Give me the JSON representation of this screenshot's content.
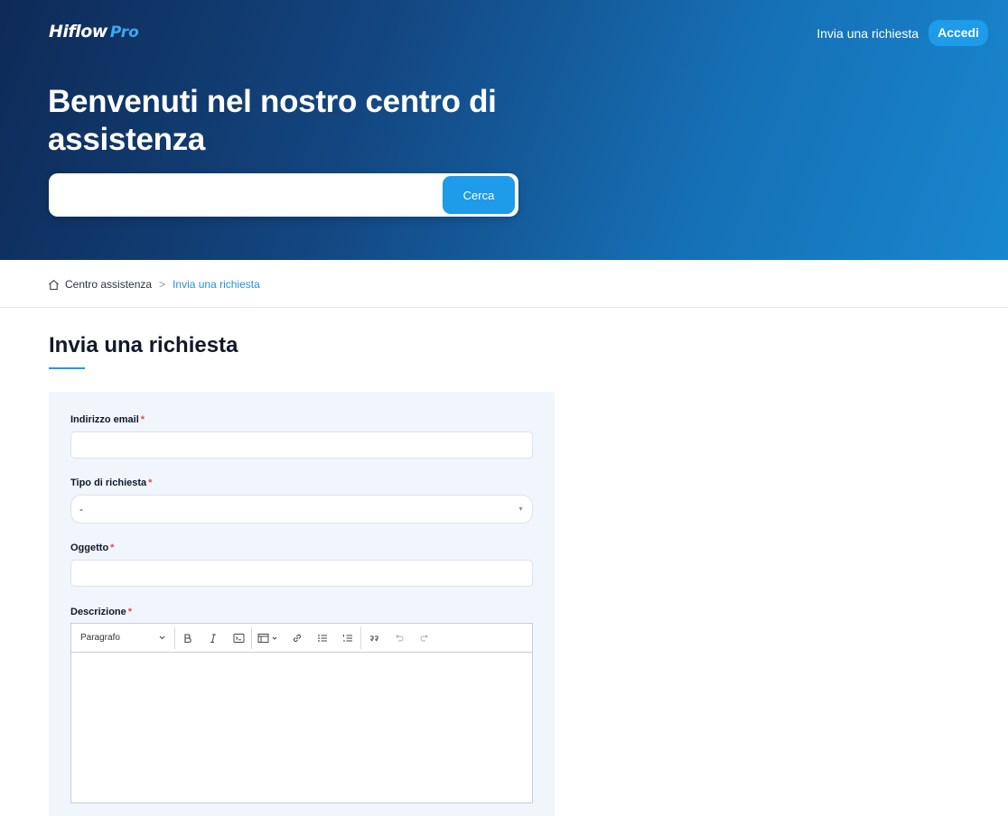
{
  "header": {
    "brand": "Hiflow",
    "brand_suffix": "Pro",
    "nav_link": "Invia una richiesta",
    "login_label": "Accedi",
    "hero_title": "Benvenuti nel nostro centro di assistenza",
    "search_placeholder": "",
    "search_button": "Cerca"
  },
  "breadcrumb": {
    "home": "Centro assistenza",
    "separator": ">",
    "current": "Invia una richiesta"
  },
  "page": {
    "title": "Invia una richiesta"
  },
  "form": {
    "email_label": "Indirizzo email",
    "email_value": "",
    "type_label": "Tipo di richiesta",
    "type_value": "-",
    "subject_label": "Oggetto",
    "subject_value": "",
    "description_label": "Descrizione",
    "required_mark": "*",
    "editor": {
      "paragraph_label": "Paragrafo",
      "tools": [
        "bold-icon",
        "italic-icon",
        "code-block-icon",
        "insert-image-icon",
        "link-icon",
        "bulleted-list-icon",
        "numbered-list-icon",
        "blockquote-icon",
        "undo-icon",
        "redo-icon"
      ]
    }
  },
  "colors": {
    "accent": "#1e9be9",
    "hero_dark": "#0e2a57",
    "hero_light": "#1887cf",
    "required": "#e24b4b",
    "panel_bg": "#f1f5fc"
  }
}
